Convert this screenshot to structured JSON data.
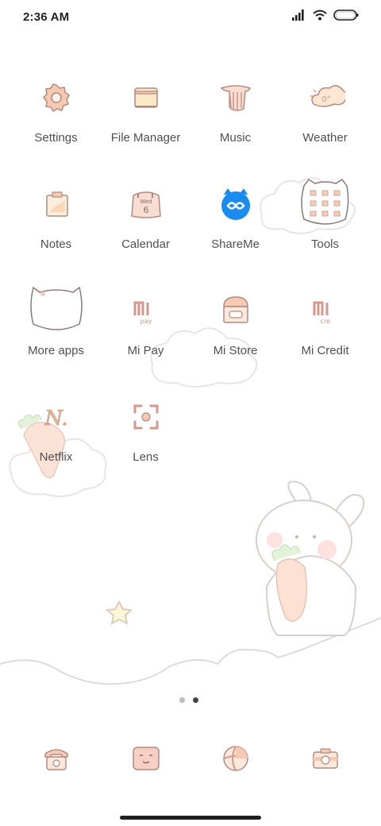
{
  "status_bar": {
    "time": "2:36 AM",
    "icons": [
      "signal-icon",
      "wifi-icon",
      "battery-icon"
    ]
  },
  "apps": [
    {
      "label": "Settings",
      "icon": "gear-icon"
    },
    {
      "label": "File Manager",
      "icon": "folder-icon"
    },
    {
      "label": "Music",
      "icon": "music-icon"
    },
    {
      "label": "Weather",
      "icon": "weather-icon",
      "icon_text": "0°"
    },
    {
      "label": "Notes",
      "icon": "notes-icon"
    },
    {
      "label": "Calendar",
      "icon": "calendar-icon",
      "icon_day": "Wed",
      "icon_date": "6"
    },
    {
      "label": "ShareMe",
      "icon": "shareme-icon"
    },
    {
      "label": "Tools",
      "icon": "tools-folder-icon"
    },
    {
      "label": "More apps",
      "icon": "more-apps-folder-icon"
    },
    {
      "label": "Mi Pay",
      "icon": "mi-pay-icon",
      "icon_text": "pay"
    },
    {
      "label": "Mi Store",
      "icon": "mi-store-icon"
    },
    {
      "label": "Mi Credit",
      "icon": "mi-credit-icon",
      "icon_text": "cre"
    },
    {
      "label": "Netflix",
      "icon": "netflix-icon",
      "icon_text": "N."
    },
    {
      "label": "Lens",
      "icon": "lens-icon"
    }
  ],
  "page_indicator": {
    "pages": 2,
    "current": 2
  },
  "dock": [
    {
      "icon": "phone-icon"
    },
    {
      "icon": "messages-icon"
    },
    {
      "icon": "browser-icon"
    },
    {
      "icon": "camera-icon"
    }
  ],
  "colors": {
    "icon_fill": "#f6d6c8",
    "icon_stroke": "#b28a82",
    "label": "#505050",
    "shareme_blue": "#1a8cf0"
  }
}
